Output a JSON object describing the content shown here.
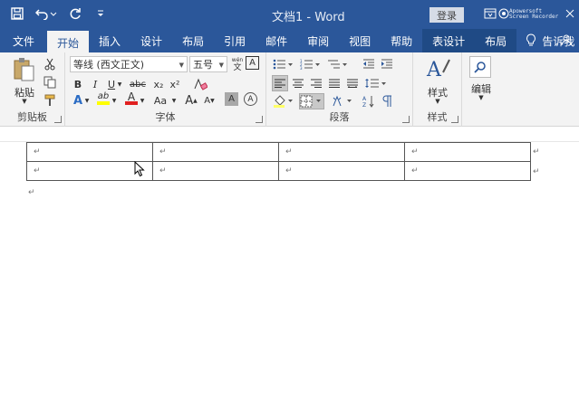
{
  "titlebar": {
    "document_title": "文档1 - Word",
    "login_label": "登录",
    "recorder_line1": "Apowersoft",
    "recorder_line2": "Screen Recorder",
    "icons": [
      "save-icon",
      "undo-icon",
      "redo-icon",
      "customize-qat-icon",
      "ribbon-display-icon",
      "minimize-icon",
      "maximize-icon",
      "close-icon"
    ]
  },
  "tabs": [
    {
      "label": "文件"
    },
    {
      "label": "开始",
      "active": true
    },
    {
      "label": "插入"
    },
    {
      "label": "设计"
    },
    {
      "label": "布局"
    },
    {
      "label": "引用"
    },
    {
      "label": "邮件"
    },
    {
      "label": "审阅"
    },
    {
      "label": "视图"
    },
    {
      "label": "帮助"
    },
    {
      "label": "表设计",
      "contextual": true
    },
    {
      "label": "布局",
      "contextual": true
    }
  ],
  "tell_me": "告诉我",
  "ribbon": {
    "clipboard": {
      "label": "剪贴板",
      "paste_label": "粘贴"
    },
    "font": {
      "label": "字体",
      "font_name": "等线 (西文正文)",
      "font_size": "五号",
      "wen_glyph": "wén",
      "wen_glyph_char": "文",
      "a_box": "A",
      "bold": "B",
      "italic": "I",
      "underline": "U",
      "strike": "abc",
      "subscript": "x₂",
      "superscript": "x²",
      "clear_format": "A",
      "text_effect": "A",
      "highlight": "ab",
      "font_color": "A",
      "change_case": "Aa",
      "grow": "A",
      "shrink": "A",
      "char_shading": "A",
      "enclose": "A"
    },
    "paragraph": {
      "label": "段落"
    },
    "styles": {
      "label": "样式",
      "button_label": "样式"
    },
    "editing": {
      "button_label": "编辑"
    }
  },
  "document": {
    "table": {
      "rows": [
        [
          "↵",
          "↵",
          "↵",
          "↵"
        ],
        [
          "↵",
          "↵",
          "↵",
          "↵"
        ]
      ],
      "row_end_mark": "↵"
    },
    "paragraph_mark": "↵"
  },
  "colors": {
    "brand": "#2b579a",
    "ribbon_bg": "#f3f3f3",
    "highlight_yellow": "#ffff00",
    "font_color_red": "#e02020"
  }
}
